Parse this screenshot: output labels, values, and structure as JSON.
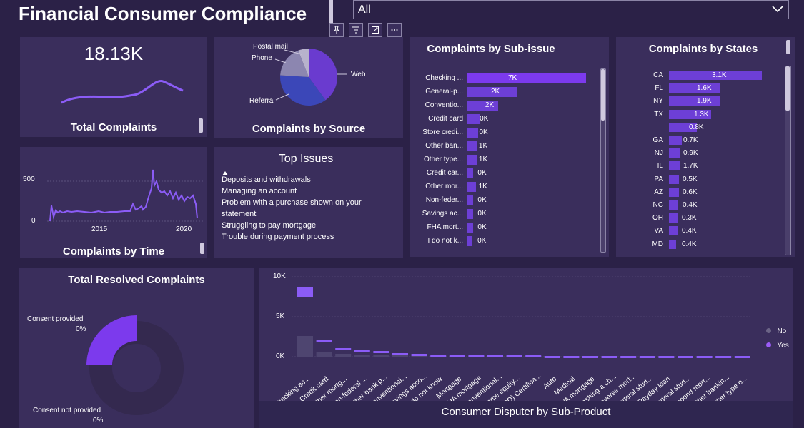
{
  "header": {
    "title": "Financial Consumer Compliance",
    "filter_value": "All"
  },
  "toolbar": {
    "pin_icon": "pin-icon",
    "filter_icon": "filter-icon",
    "focus_icon": "focus-mode-icon",
    "more_icon": "more-options-icon"
  },
  "total_complaints": {
    "value": "18.13K",
    "label": "Total Complaints"
  },
  "complaints_by_source": {
    "label": "Complaints by Source",
    "slices": [
      {
        "name": "Web",
        "share": 0.6,
        "color": "#6a3bcf"
      },
      {
        "name": "Referral",
        "share": 0.25,
        "color": "#3b47b8"
      },
      {
        "name": "Phone",
        "share": 0.09,
        "color": "#8c86b0"
      },
      {
        "name": "Postal mail",
        "share": 0.06,
        "color": "#b7b2cc"
      }
    ]
  },
  "sub_issue": {
    "title": "Complaints by Sub-issue",
    "rows": [
      {
        "label": "Checking ...",
        "value": "7K",
        "fill": 1.0
      },
      {
        "label": "General-p...",
        "value": "2K",
        "fill": 0.42
      },
      {
        "label": "Conventio...",
        "value": "2K",
        "fill": 0.26
      },
      {
        "label": "Credit card",
        "value": "0K",
        "fill": 0.1
      },
      {
        "label": "Store credi...",
        "value": "0K",
        "fill": 0.09
      },
      {
        "label": "Other ban...",
        "value": "1K",
        "fill": 0.08
      },
      {
        "label": "Other type...",
        "value": "1K",
        "fill": 0.08
      },
      {
        "label": "Credit car...",
        "value": "0K",
        "fill": 0.05
      },
      {
        "label": "Other mor...",
        "value": "1K",
        "fill": 0.07
      },
      {
        "label": "Non-feder...",
        "value": "0K",
        "fill": 0.05
      },
      {
        "label": "Savings ac...",
        "value": "0K",
        "fill": 0.05
      },
      {
        "label": "FHA mort...",
        "value": "0K",
        "fill": 0.05
      },
      {
        "label": "I do not k...",
        "value": "0K",
        "fill": 0.04
      }
    ]
  },
  "states": {
    "title": "Complaints by States",
    "rows": [
      {
        "label": "CA",
        "value": "3.1K",
        "fill": 1.0
      },
      {
        "label": "FL",
        "value": "1.6K",
        "fill": 0.55
      },
      {
        "label": "NY",
        "value": "1.9K",
        "fill": 0.55
      },
      {
        "label": "TX",
        "value": "1.3K",
        "fill": 0.45
      },
      {
        "label": "",
        "value": "0.8K",
        "fill": 0.3
      },
      {
        "label": "GA",
        "value": "0.7K",
        "fill": 0.14
      },
      {
        "label": "NJ",
        "value": "0.9K",
        "fill": 0.12
      },
      {
        "label": "IL",
        "value": "1.7K",
        "fill": 0.12
      },
      {
        "label": "PA",
        "value": "0.5K",
        "fill": 0.11
      },
      {
        "label": "AZ",
        "value": "0.6K",
        "fill": 0.11
      },
      {
        "label": "NC",
        "value": "0.4K",
        "fill": 0.1
      },
      {
        "label": "OH",
        "value": "0.3K",
        "fill": 0.09
      },
      {
        "label": "VA",
        "value": "0.4K",
        "fill": 0.09
      },
      {
        "label": "MD",
        "value": "0.4K",
        "fill": 0.08
      }
    ]
  },
  "complaints_by_time": {
    "label": "Complaints by Time",
    "y_ticks": [
      "500",
      "0"
    ],
    "x_ticks": [
      "2015",
      "2020"
    ]
  },
  "top_issues": {
    "title": "Top Issues",
    "items": [
      "Deposits and withdrawals",
      "Managing an account",
      "Problem with a purchase shown on your statement",
      "Struggling to pay mortgage",
      "Trouble during payment process"
    ]
  },
  "resolved": {
    "title": "Total Resolved Complaints",
    "consent_provided": "Consent provided",
    "consent_provided_pct": "0%",
    "consent_not_provided": "Consent not provided",
    "consent_not_provided_pct": "0%"
  },
  "disputer": {
    "title": "Consumer Disputer by Sub-Product",
    "y_ticks": [
      "10K",
      "5K",
      "0K"
    ],
    "legend": [
      {
        "label": "No",
        "color": "#6b6486"
      },
      {
        "label": "Yes",
        "color": "#9b5cf6"
      }
    ],
    "categories": [
      "Checking ac...",
      "Credit card",
      "Other mortg...",
      "Non-federal ...",
      "Other bank p...",
      "Conventional...",
      "Savings acco...",
      "I do not know",
      "Mortgage",
      "FHA mortgage",
      "Conventional...",
      "Home equity...",
      "(CD) Certifica...",
      "Auto",
      "Medical",
      "VA mortgage",
      "Cashing a ch...",
      "Reverse mort...",
      "Federal stud...",
      "Payday loan",
      "Federal stud...",
      "Second mort...",
      "Other bankin...",
      "Other type o..."
    ]
  },
  "chart_data": [
    {
      "type": "bar",
      "title": "Complaints by Sub-issue",
      "categories": [
        "Checking ...",
        "General-p...",
        "Conventio...",
        "Credit card",
        "Store credi...",
        "Other ban...",
        "Other type...",
        "Credit car...",
        "Other mor...",
        "Non-feder...",
        "Savings ac...",
        "FHA mort...",
        "I do not k..."
      ],
      "values": [
        7000,
        2000,
        2000,
        0,
        0,
        1000,
        1000,
        0,
        1000,
        0,
        0,
        0,
        0
      ]
    },
    {
      "type": "bar",
      "title": "Complaints by States",
      "categories": [
        "CA",
        "FL",
        "NY",
        "TX",
        "",
        "GA",
        "NJ",
        "IL",
        "PA",
        "AZ",
        "NC",
        "OH",
        "VA",
        "MD"
      ],
      "values": [
        3100,
        1600,
        1900,
        1300,
        800,
        700,
        900,
        1700,
        500,
        600,
        400,
        300,
        400,
        400
      ]
    },
    {
      "type": "pie",
      "title": "Complaints by Source",
      "categories": [
        "Web",
        "Referral",
        "Phone",
        "Postal mail"
      ],
      "values": [
        0.6,
        0.25,
        0.09,
        0.06
      ]
    }
  ]
}
